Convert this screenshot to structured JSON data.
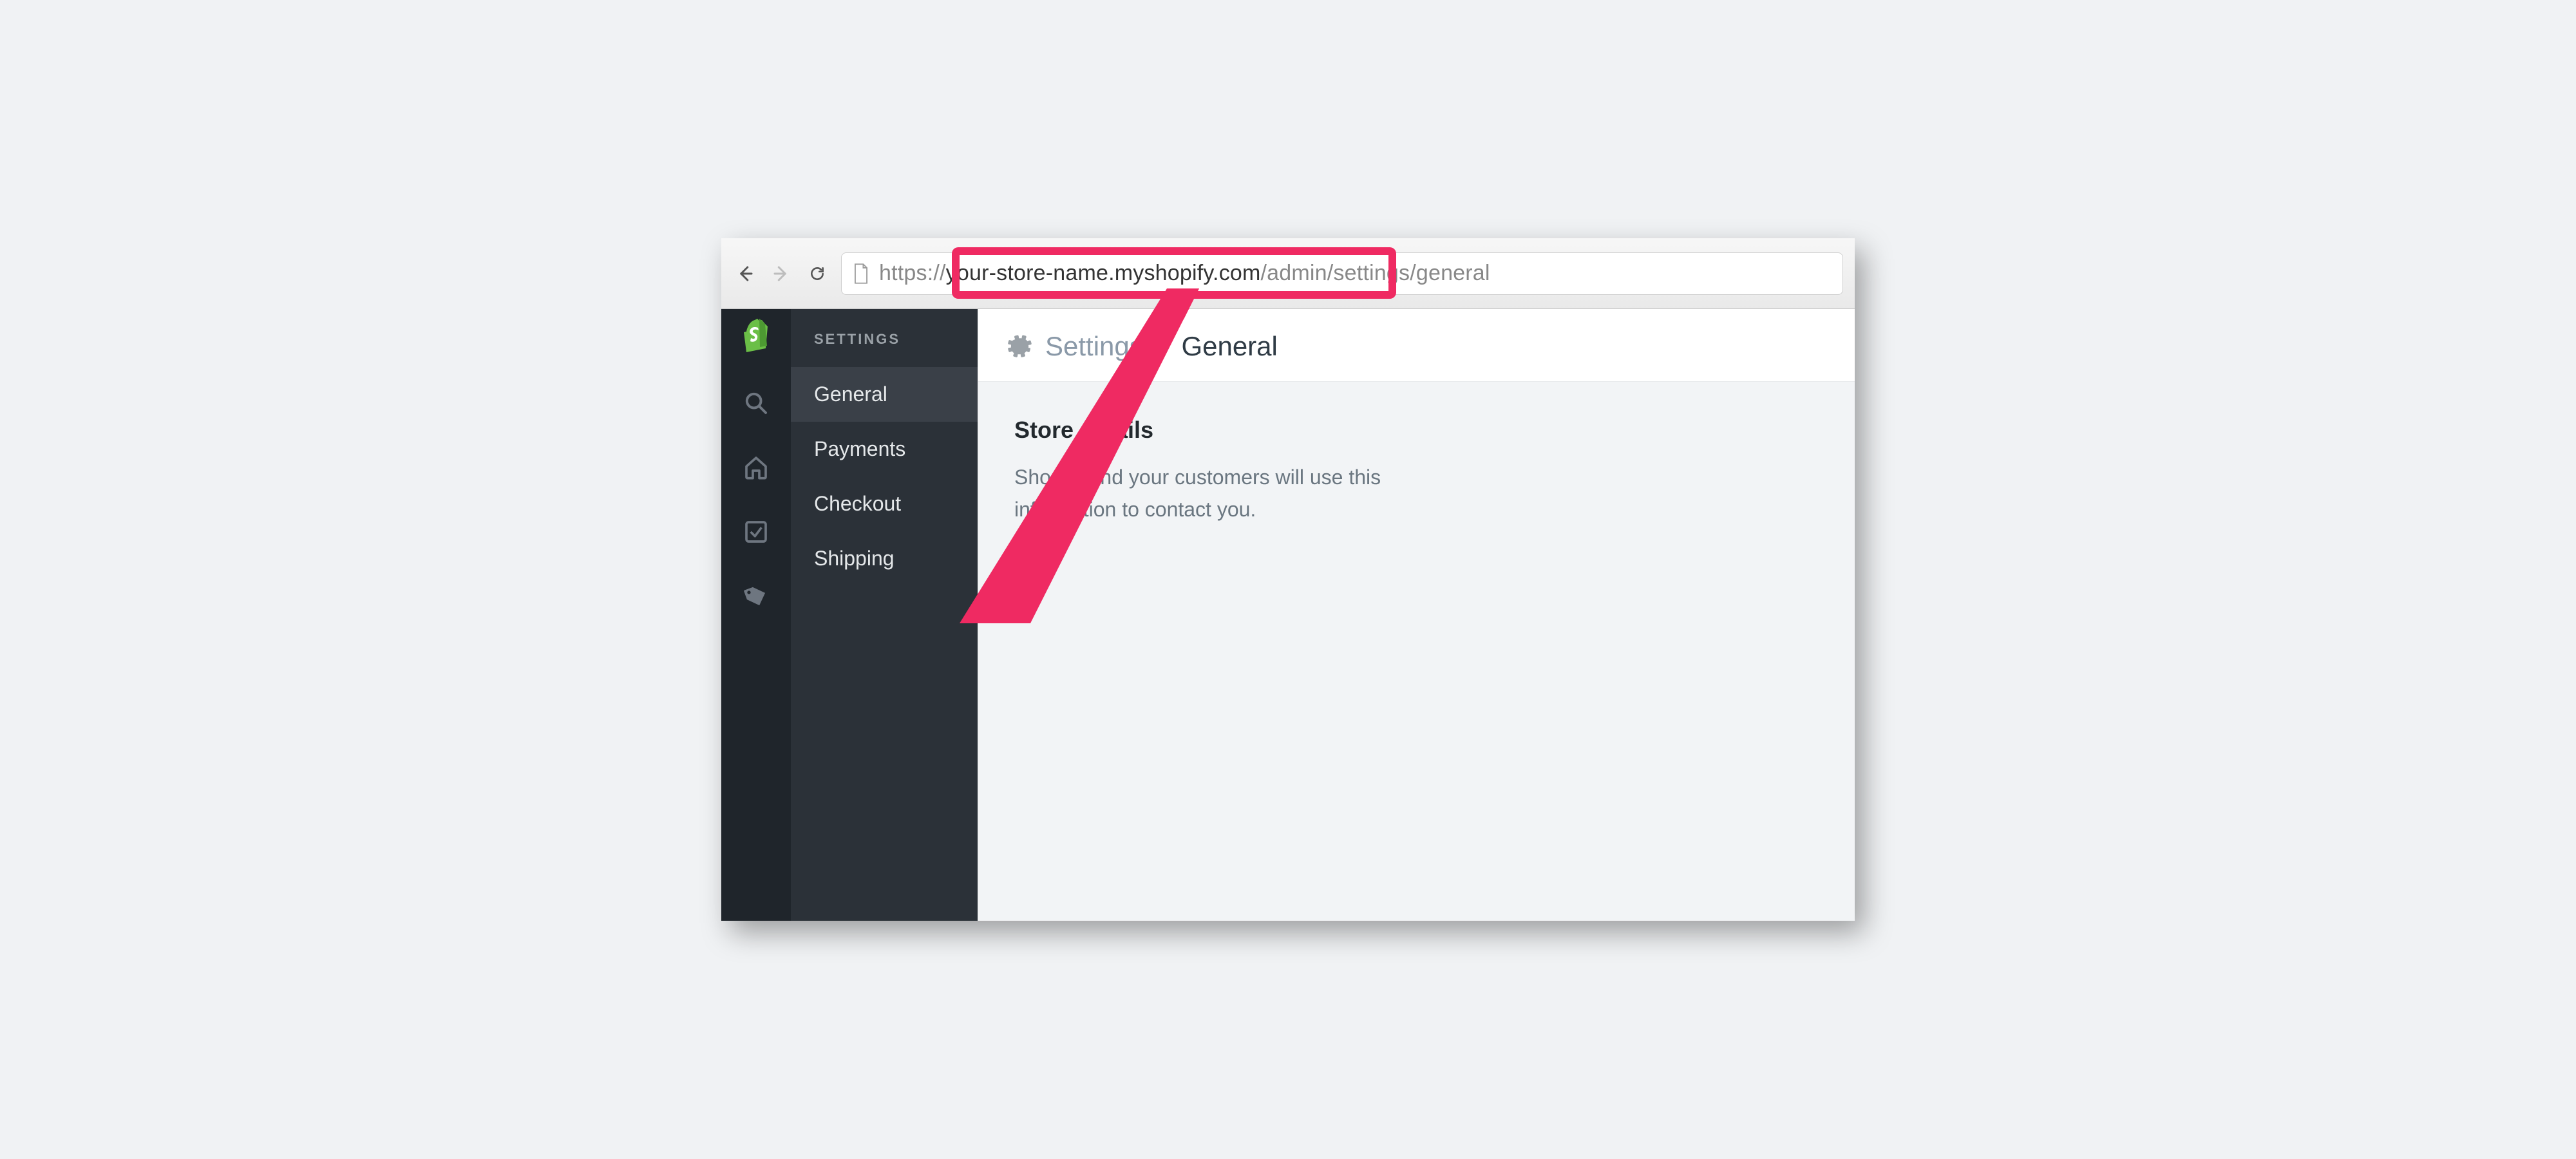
{
  "browser": {
    "url_scheme": "https://",
    "url_domain": "your-store-name.myshopify.com",
    "url_path": "/admin/settings/general"
  },
  "sidebar": {
    "heading": "SETTINGS",
    "items": [
      {
        "label": "General"
      },
      {
        "label": "Payments"
      },
      {
        "label": "Checkout"
      },
      {
        "label": "Shipping"
      }
    ],
    "active_index": 0
  },
  "breadcrumb": {
    "parent": "Settings",
    "sep": "/",
    "current": "General"
  },
  "section": {
    "title": "Store details",
    "description": "Shopify and your customers will use this information to contact you."
  },
  "annotation": {
    "highlight_color": "#ef2a62"
  }
}
